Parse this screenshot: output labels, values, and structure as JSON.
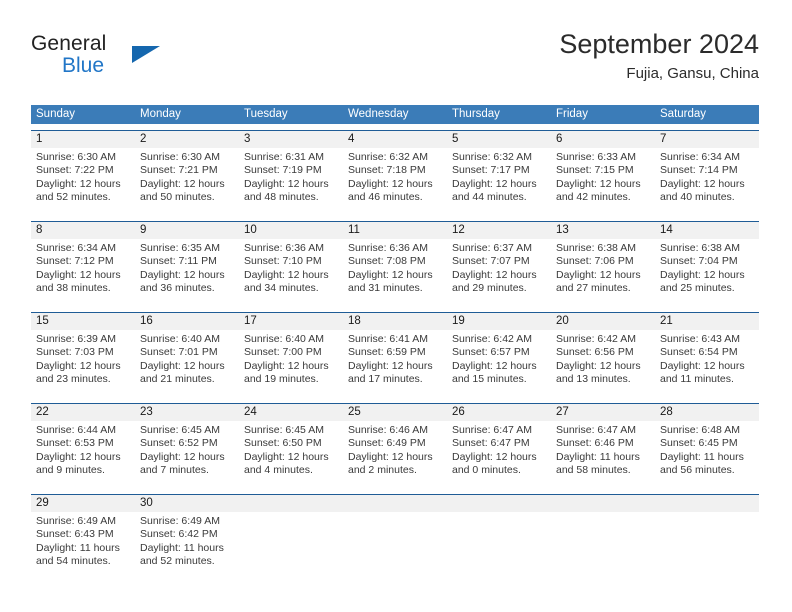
{
  "brand": {
    "word_one": "General",
    "word_two": "Blue",
    "logo_icon": "triangle-icon"
  },
  "header": {
    "title": "September 2024",
    "subtitle": "Fujia, Gansu, China"
  },
  "colors": {
    "header_row_bg": "#3b7cb8",
    "week_divider": "#1f5c96",
    "day_number_bg": "#f1f1f1",
    "brand_blue": "#2176c7",
    "logo_triangle": "#1567ae",
    "text": "#3a3a3a"
  },
  "weekdays": [
    "Sunday",
    "Monday",
    "Tuesday",
    "Wednesday",
    "Thursday",
    "Friday",
    "Saturday"
  ],
  "weeks": [
    [
      {
        "day": "1",
        "sunrise": "Sunrise: 6:30 AM",
        "sunset": "Sunset: 7:22 PM",
        "daylight_1": "Daylight: 12 hours",
        "daylight_2": "and 52 minutes."
      },
      {
        "day": "2",
        "sunrise": "Sunrise: 6:30 AM",
        "sunset": "Sunset: 7:21 PM",
        "daylight_1": "Daylight: 12 hours",
        "daylight_2": "and 50 minutes."
      },
      {
        "day": "3",
        "sunrise": "Sunrise: 6:31 AM",
        "sunset": "Sunset: 7:19 PM",
        "daylight_1": "Daylight: 12 hours",
        "daylight_2": "and 48 minutes."
      },
      {
        "day": "4",
        "sunrise": "Sunrise: 6:32 AM",
        "sunset": "Sunset: 7:18 PM",
        "daylight_1": "Daylight: 12 hours",
        "daylight_2": "and 46 minutes."
      },
      {
        "day": "5",
        "sunrise": "Sunrise: 6:32 AM",
        "sunset": "Sunset: 7:17 PM",
        "daylight_1": "Daylight: 12 hours",
        "daylight_2": "and 44 minutes."
      },
      {
        "day": "6",
        "sunrise": "Sunrise: 6:33 AM",
        "sunset": "Sunset: 7:15 PM",
        "daylight_1": "Daylight: 12 hours",
        "daylight_2": "and 42 minutes."
      },
      {
        "day": "7",
        "sunrise": "Sunrise: 6:34 AM",
        "sunset": "Sunset: 7:14 PM",
        "daylight_1": "Daylight: 12 hours",
        "daylight_2": "and 40 minutes."
      }
    ],
    [
      {
        "day": "8",
        "sunrise": "Sunrise: 6:34 AM",
        "sunset": "Sunset: 7:12 PM",
        "daylight_1": "Daylight: 12 hours",
        "daylight_2": "and 38 minutes."
      },
      {
        "day": "9",
        "sunrise": "Sunrise: 6:35 AM",
        "sunset": "Sunset: 7:11 PM",
        "daylight_1": "Daylight: 12 hours",
        "daylight_2": "and 36 minutes."
      },
      {
        "day": "10",
        "sunrise": "Sunrise: 6:36 AM",
        "sunset": "Sunset: 7:10 PM",
        "daylight_1": "Daylight: 12 hours",
        "daylight_2": "and 34 minutes."
      },
      {
        "day": "11",
        "sunrise": "Sunrise: 6:36 AM",
        "sunset": "Sunset: 7:08 PM",
        "daylight_1": "Daylight: 12 hours",
        "daylight_2": "and 31 minutes."
      },
      {
        "day": "12",
        "sunrise": "Sunrise: 6:37 AM",
        "sunset": "Sunset: 7:07 PM",
        "daylight_1": "Daylight: 12 hours",
        "daylight_2": "and 29 minutes."
      },
      {
        "day": "13",
        "sunrise": "Sunrise: 6:38 AM",
        "sunset": "Sunset: 7:06 PM",
        "daylight_1": "Daylight: 12 hours",
        "daylight_2": "and 27 minutes."
      },
      {
        "day": "14",
        "sunrise": "Sunrise: 6:38 AM",
        "sunset": "Sunset: 7:04 PM",
        "daylight_1": "Daylight: 12 hours",
        "daylight_2": "and 25 minutes."
      }
    ],
    [
      {
        "day": "15",
        "sunrise": "Sunrise: 6:39 AM",
        "sunset": "Sunset: 7:03 PM",
        "daylight_1": "Daylight: 12 hours",
        "daylight_2": "and 23 minutes."
      },
      {
        "day": "16",
        "sunrise": "Sunrise: 6:40 AM",
        "sunset": "Sunset: 7:01 PM",
        "daylight_1": "Daylight: 12 hours",
        "daylight_2": "and 21 minutes."
      },
      {
        "day": "17",
        "sunrise": "Sunrise: 6:40 AM",
        "sunset": "Sunset: 7:00 PM",
        "daylight_1": "Daylight: 12 hours",
        "daylight_2": "and 19 minutes."
      },
      {
        "day": "18",
        "sunrise": "Sunrise: 6:41 AM",
        "sunset": "Sunset: 6:59 PM",
        "daylight_1": "Daylight: 12 hours",
        "daylight_2": "and 17 minutes."
      },
      {
        "day": "19",
        "sunrise": "Sunrise: 6:42 AM",
        "sunset": "Sunset: 6:57 PM",
        "daylight_1": "Daylight: 12 hours",
        "daylight_2": "and 15 minutes."
      },
      {
        "day": "20",
        "sunrise": "Sunrise: 6:42 AM",
        "sunset": "Sunset: 6:56 PM",
        "daylight_1": "Daylight: 12 hours",
        "daylight_2": "and 13 minutes."
      },
      {
        "day": "21",
        "sunrise": "Sunrise: 6:43 AM",
        "sunset": "Sunset: 6:54 PM",
        "daylight_1": "Daylight: 12 hours",
        "daylight_2": "and 11 minutes."
      }
    ],
    [
      {
        "day": "22",
        "sunrise": "Sunrise: 6:44 AM",
        "sunset": "Sunset: 6:53 PM",
        "daylight_1": "Daylight: 12 hours",
        "daylight_2": "and 9 minutes."
      },
      {
        "day": "23",
        "sunrise": "Sunrise: 6:45 AM",
        "sunset": "Sunset: 6:52 PM",
        "daylight_1": "Daylight: 12 hours",
        "daylight_2": "and 7 minutes."
      },
      {
        "day": "24",
        "sunrise": "Sunrise: 6:45 AM",
        "sunset": "Sunset: 6:50 PM",
        "daylight_1": "Daylight: 12 hours",
        "daylight_2": "and 4 minutes."
      },
      {
        "day": "25",
        "sunrise": "Sunrise: 6:46 AM",
        "sunset": "Sunset: 6:49 PM",
        "daylight_1": "Daylight: 12 hours",
        "daylight_2": "and 2 minutes."
      },
      {
        "day": "26",
        "sunrise": "Sunrise: 6:47 AM",
        "sunset": "Sunset: 6:47 PM",
        "daylight_1": "Daylight: 12 hours",
        "daylight_2": "and 0 minutes."
      },
      {
        "day": "27",
        "sunrise": "Sunrise: 6:47 AM",
        "sunset": "Sunset: 6:46 PM",
        "daylight_1": "Daylight: 11 hours",
        "daylight_2": "and 58 minutes."
      },
      {
        "day": "28",
        "sunrise": "Sunrise: 6:48 AM",
        "sunset": "Sunset: 6:45 PM",
        "daylight_1": "Daylight: 11 hours",
        "daylight_2": "and 56 minutes."
      }
    ],
    [
      {
        "day": "29",
        "sunrise": "Sunrise: 6:49 AM",
        "sunset": "Sunset: 6:43 PM",
        "daylight_1": "Daylight: 11 hours",
        "daylight_2": "and 54 minutes."
      },
      {
        "day": "30",
        "sunrise": "Sunrise: 6:49 AM",
        "sunset": "Sunset: 6:42 PM",
        "daylight_1": "Daylight: 11 hours",
        "daylight_2": "and 52 minutes."
      },
      {
        "day": "",
        "sunrise": "",
        "sunset": "",
        "daylight_1": "",
        "daylight_2": ""
      },
      {
        "day": "",
        "sunrise": "",
        "sunset": "",
        "daylight_1": "",
        "daylight_2": ""
      },
      {
        "day": "",
        "sunrise": "",
        "sunset": "",
        "daylight_1": "",
        "daylight_2": ""
      },
      {
        "day": "",
        "sunrise": "",
        "sunset": "",
        "daylight_1": "",
        "daylight_2": ""
      },
      {
        "day": "",
        "sunrise": "",
        "sunset": "",
        "daylight_1": "",
        "daylight_2": ""
      }
    ]
  ]
}
